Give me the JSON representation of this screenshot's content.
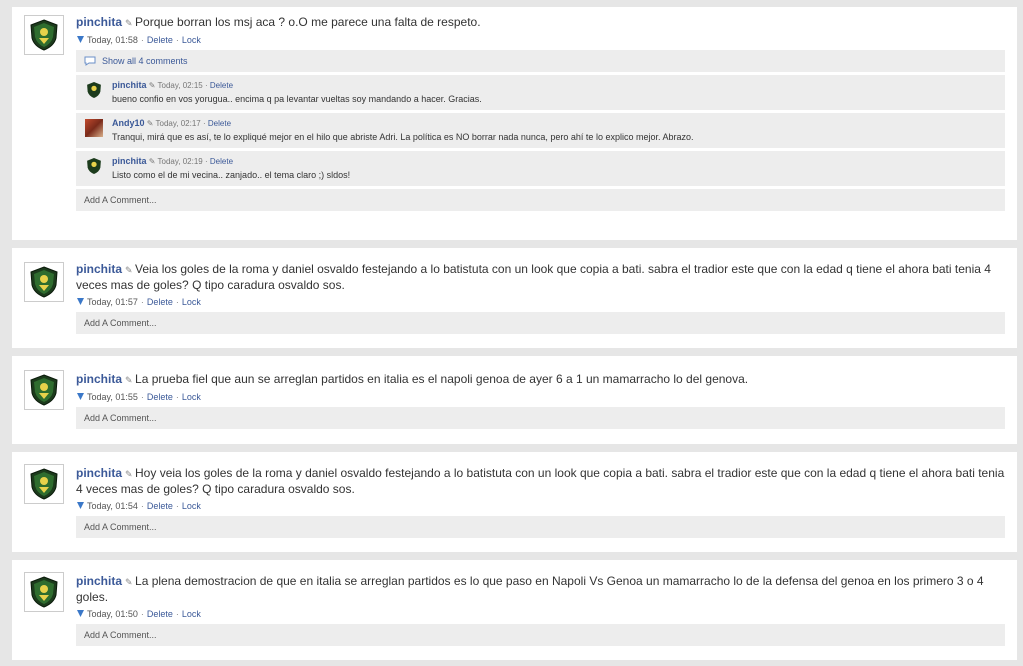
{
  "common": {
    "time_prefix": "Today,",
    "delete_label": "Delete",
    "lock_label": "Lock",
    "add_comment": "Add A Comment...",
    "sep": "·"
  },
  "posts": [
    {
      "user": "pinchita",
      "text": "Porque borran los msj aca ? o.O me parece una falta de respeto.",
      "time": "Today, 01:58",
      "show_all": "Show all 4 comments",
      "comments": [
        {
          "user": "pinchita",
          "time": "Today, 02:15",
          "text": "bueno confio en vos yorugua.. encima q pa levantar vueltas soy mandando a hacer. Gracias."
        },
        {
          "user": "Andy10",
          "time": "Today, 02:17",
          "text": "Tranqui, mirá que es así, te lo expliqué mejor en el hilo que abriste Adri. La política es NO borrar nada nunca, pero ahí te lo explico mejor. Abrazo."
        },
        {
          "user": "pinchita",
          "time": "Today, 02:19",
          "text": "Listo como el de mi vecina.. zanjado.. el tema claro ;) sldos!"
        }
      ]
    },
    {
      "user": "pinchita",
      "text": "Veia los goles de la roma y daniel osvaldo festejando a lo batistuta con un look que copia a bati. sabra el tradior este que con la edad q tiene el ahora bati tenia 4 veces mas de goles? Q tipo caradura osvaldo sos.",
      "time": "Today, 01:57"
    },
    {
      "user": "pinchita",
      "text": "La prueba fiel que aun se arreglan partidos en italia es el napoli genoa de ayer 6 a 1 un mamarracho lo del genova.",
      "time": "Today, 01:55"
    },
    {
      "user": "pinchita",
      "text": "Hoy veia los goles de la roma y daniel osvaldo festejando a lo batistuta con un look que copia a bati. sabra el tradior este que con la edad q tiene el ahora bati tenia 4 veces mas de goles? Q tipo caradura osvaldo sos.",
      "time": "Today, 01:54"
    },
    {
      "user": "pinchita",
      "text": "La plena demostracion de que en italia se arreglan partidos es lo que paso en Napoli Vs Genoa un mamarracho lo de la defensa del genoa en los primero 3 o 4 goles.",
      "time": "Today, 01:50"
    }
  ]
}
